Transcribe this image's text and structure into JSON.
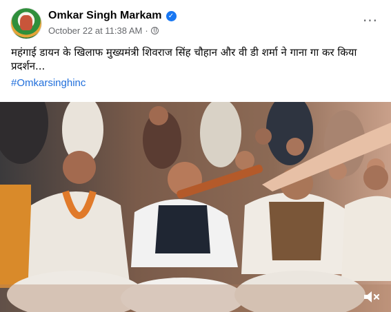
{
  "post": {
    "author": "Omkar Singh Markam",
    "date": "October 22 at 11:38 AM",
    "separator": "·",
    "more_label": "···",
    "text": "महंगाई डायन के खिलाफ मुख्यमंत्री शिवराज सिंह चौहान और वी डी शर्मा ने गाना गा कर किया प्रदर्शन...",
    "hashtag": "#Omkarsinghinc"
  },
  "icons": {
    "verified": "verified-check-icon",
    "privacy": "globe-icon",
    "more": "more-options-icon",
    "volume": "volume-muted-icon"
  },
  "colors": {
    "accent": "#1877f2",
    "hashtag": "#216fdb",
    "meta": "#65676b"
  }
}
